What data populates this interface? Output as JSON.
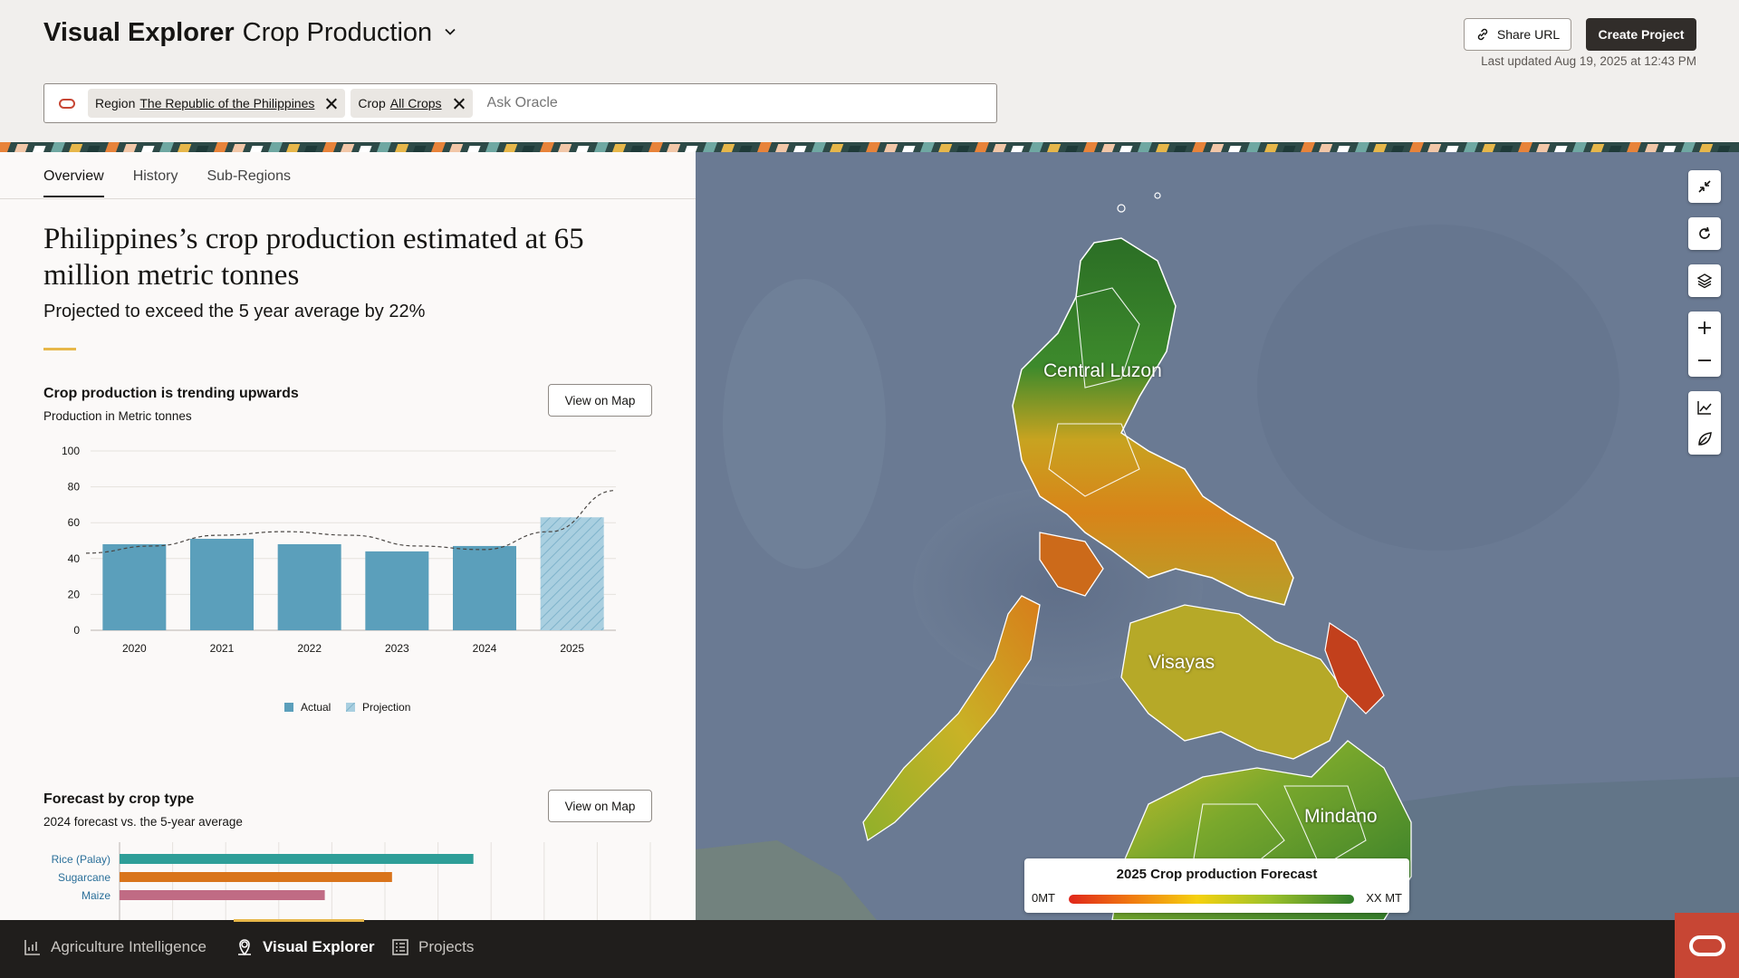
{
  "header": {
    "app_title": "Visual Explorer",
    "section_title": "Crop Production",
    "share_label": "Share URL",
    "create_label": "Create Project",
    "last_updated": "Last updated Aug 19, 2025 at 12:43 PM"
  },
  "search": {
    "chips": [
      {
        "key": "Region",
        "value": "The Republic of the Philippines"
      },
      {
        "key": "Crop",
        "value": "All Crops"
      }
    ],
    "placeholder": "Ask Oracle"
  },
  "tabs": [
    {
      "label": "Overview",
      "active": true
    },
    {
      "label": "History",
      "active": false
    },
    {
      "label": "Sub-Regions",
      "active": false
    }
  ],
  "overview": {
    "headline": "Philippines’s crop production estimated at 65 million metric tonnes",
    "subheadline": "Projected to exceed the 5 year average by 22%"
  },
  "trend_card": {
    "title": "Crop production is trending upwards",
    "subtitle": "Production in Metric tonnes",
    "button": "View on Map"
  },
  "forecast_card": {
    "title": "Forecast by crop type",
    "subtitle": "2024 forecast vs. the 5-year average",
    "button": "View on Map"
  },
  "chart_data": [
    {
      "type": "bar",
      "categories": [
        "2020",
        "2021",
        "2022",
        "2023",
        "2024",
        "2025"
      ],
      "series": [
        {
          "name": "Actual",
          "values": [
            48,
            51,
            48,
            44,
            47,
            null
          ],
          "color": "#5b9fbb"
        },
        {
          "name": "Projection",
          "values": [
            null,
            null,
            null,
            null,
            null,
            63
          ],
          "color": "#a9cfe0"
        }
      ],
      "trend_line": [
        43,
        47,
        53,
        55,
        53,
        47,
        45,
        55,
        78
      ],
      "ylim": [
        0,
        100
      ],
      "yticks": [
        "0",
        "20",
        "40",
        "60",
        "80",
        "100"
      ],
      "grid": true,
      "legend": "bottom"
    },
    {
      "type": "bar",
      "orientation": "horizontal",
      "categories": [
        "Rice (Palay)",
        "Sugarcane",
        "Maize"
      ],
      "values": [
        100,
        77,
        58
      ],
      "colors": [
        "#2e9e98",
        "#d9741b",
        "#c06b84"
      ],
      "grid": true
    }
  ],
  "map": {
    "legend_title": "2025 Crop production Forecast",
    "legend_min": "0MT",
    "legend_max": "XX MT",
    "regions": [
      "Central Luzon",
      "Visayas",
      "Mindano"
    ],
    "colors": {
      "sea": "#687891",
      "high": "#2f7d2a",
      "mid": "#f5d10f",
      "low": "#e0261b"
    }
  },
  "nav": {
    "items": [
      {
        "label": "Agriculture Intelligence",
        "icon": "chart-icon",
        "active": false
      },
      {
        "label": "Visual Explorer",
        "icon": "map-pin-icon",
        "active": true
      },
      {
        "label": "Projects",
        "icon": "projects-icon",
        "active": false
      }
    ]
  },
  "colors": {
    "accent": "#e7b74a",
    "oracle_red": "#c74634",
    "dark": "#312d2a"
  }
}
